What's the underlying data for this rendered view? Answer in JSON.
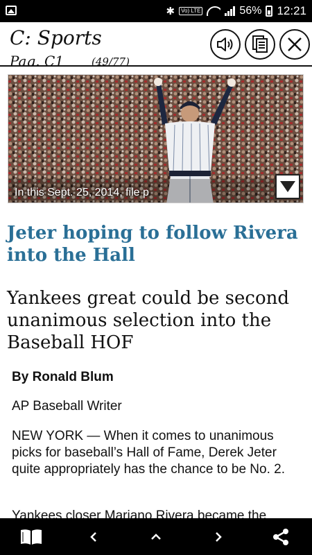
{
  "status_bar": {
    "battery": "56%",
    "time": "12:21",
    "volte": "Vo) LTE",
    "icons": [
      "gallery-icon",
      "bluetooth-icon",
      "wifi-icon",
      "signal-icon",
      "battery-icon"
    ]
  },
  "header": {
    "section_title": "C: Sports",
    "page_label": "Pag. C1",
    "page_count": "(49/77)",
    "buttons": [
      "speaker-icon",
      "pages-icon",
      "close-icon"
    ]
  },
  "photo": {
    "caption": "In this Sept. 25, 2014, file p"
  },
  "article": {
    "headline": "Jeter hoping to follow Rivera into the Hall",
    "subheadline": "Yankees great could be second unanimous selection into the Baseball HOF",
    "byline": "By Ronald Blum",
    "role": "AP Baseball Writer",
    "paragraph_1": "NEW YORK — When it comes to unanimous picks for baseball’s Hall of Fame, Derek Jeter quite appropriately has the chance to be No. 2.",
    "paragraph_2": "Yankees closer Mariano Rivera became the"
  },
  "bottom_nav": {
    "buttons": [
      "book-icon",
      "chevron-left-icon",
      "chevron-up-icon",
      "chevron-right-icon",
      "share-icon"
    ]
  },
  "colors": {
    "headline": "#2a6f96",
    "bars": "#000000"
  }
}
